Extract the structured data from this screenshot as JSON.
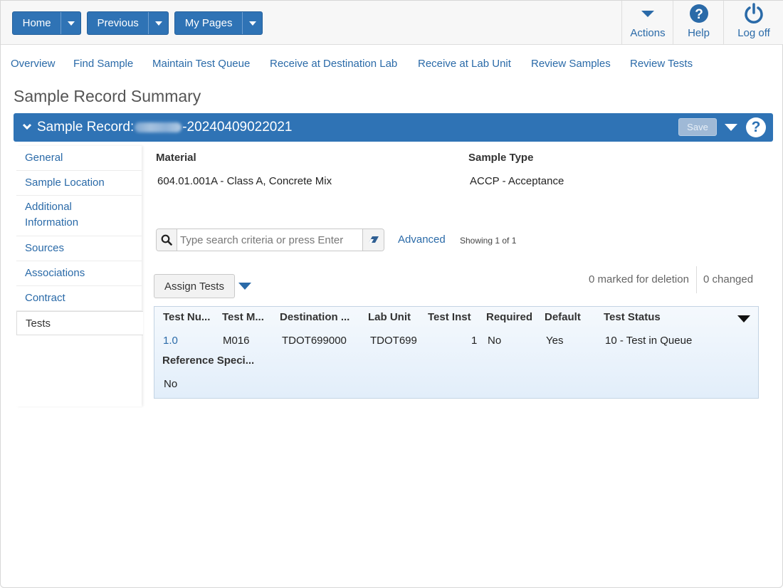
{
  "topbar": {
    "buttons": [
      {
        "label": "Home"
      },
      {
        "label": "Previous"
      },
      {
        "label": "My Pages"
      }
    ],
    "actions_label": "Actions",
    "help_label": "Help",
    "logoff_label": "Log off",
    "icons": {
      "actions": "caret-down-icon",
      "help": "help-circle-icon",
      "logoff": "power-icon"
    }
  },
  "nav_links": [
    "Overview",
    "Find Sample",
    "Maintain Test Queue",
    "Receive at Destination Lab",
    "Receive at Lab Unit",
    "Review Samples",
    "Review Tests"
  ],
  "page_title": "Sample Record Summary",
  "record_header": {
    "prefix": "Sample Record:",
    "suffix": "-20240409022021",
    "save_label": "Save"
  },
  "sidebar": {
    "items": [
      {
        "label": "General"
      },
      {
        "label": "Sample Location"
      },
      {
        "label": "Additional Information"
      },
      {
        "label": "Sources"
      },
      {
        "label": "Associations"
      },
      {
        "label": "Contract"
      },
      {
        "label": "Tests",
        "active": true
      }
    ]
  },
  "summary": {
    "material_label": "Material",
    "material_value": "604.01.001A - Class A, Concrete Mix",
    "sample_type_label": "Sample Type",
    "sample_type_value": "ACCP - Acceptance"
  },
  "search": {
    "placeholder": "Type search criteria or press Enter",
    "value": "",
    "advanced_label": "Advanced",
    "showing": "Showing 1 of 1"
  },
  "toolbar": {
    "assign_label": "Assign Tests",
    "marked_deletion": "0 marked for deletion",
    "changed": "0 changed"
  },
  "grid": {
    "headers": [
      "Test Nu...",
      "Test M...",
      "Destination ...",
      "Lab Unit",
      "Test Inst",
      "Required",
      "Default",
      "Test Status"
    ],
    "row": {
      "test_number": "1.0",
      "test_method": "M016",
      "destination": "TDOT699000",
      "lab_unit": "TDOT699",
      "test_inst": "1",
      "required": "No",
      "default": "Yes",
      "status": "10 - Test in Queue"
    },
    "ref_spec_label": "Reference Speci...",
    "ref_spec_value": "No"
  },
  "colors": {
    "primary": "#2f73b5",
    "link": "#2a6aa8",
    "grid_bg": "#e2eefa"
  }
}
